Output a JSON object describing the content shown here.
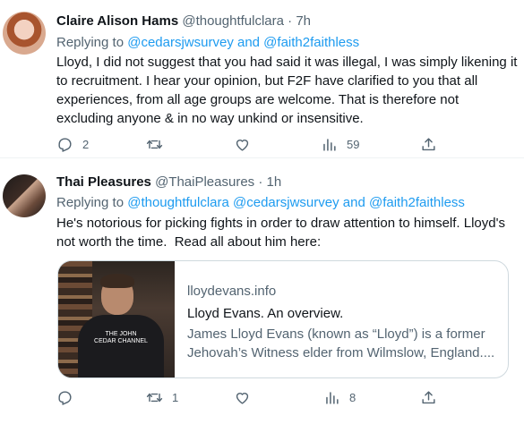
{
  "tweets": [
    {
      "author_name": "Claire Alison Hams",
      "author_handle": "@thoughtfulclara",
      "time": "· 7h",
      "replying_prefix": "Replying to ",
      "replying_mentions": "@cedarsjwsurvey and @faith2faithless",
      "body": "Lloyd, I did not suggest that you had said it was illegal, I was simply likening it to recruitment. I hear your opinion, but F2F have clarified to you that all experiences, from all age groups are welcome. That is therefore not excluding anyone & in no way unkind or insensitive.",
      "reply_count": "2",
      "retweet_count": "",
      "like_count": "",
      "views_count": "59"
    },
    {
      "author_name": "Thai Pleasures",
      "author_handle": "@ThaiPleasures",
      "time": "· 1h",
      "replying_prefix": "Replying to ",
      "replying_mentions": "@thoughtfulclara @cedarsjwsurvey and @faith2faithless",
      "body": "He's notorious for picking fights in order to draw attention to himself. Lloyd's not worth the time.  Read all about him here:",
      "card": {
        "domain": "lloydevans.info",
        "title": "Lloyd Evans. An overview.",
        "description_line1": "James Lloyd Evans (known as “Lloyd”) is a former",
        "description_line2": "Jehovah’s Witness elder from Wilmslow, England....",
        "shirt_text": "THE JOHN CEDAR CHANNEL"
      },
      "reply_count": "",
      "retweet_count": "1",
      "like_count": "",
      "views_count": "8"
    }
  ],
  "icons": [
    "reply-icon",
    "retweet-icon",
    "like-icon",
    "views-icon",
    "share-icon"
  ]
}
